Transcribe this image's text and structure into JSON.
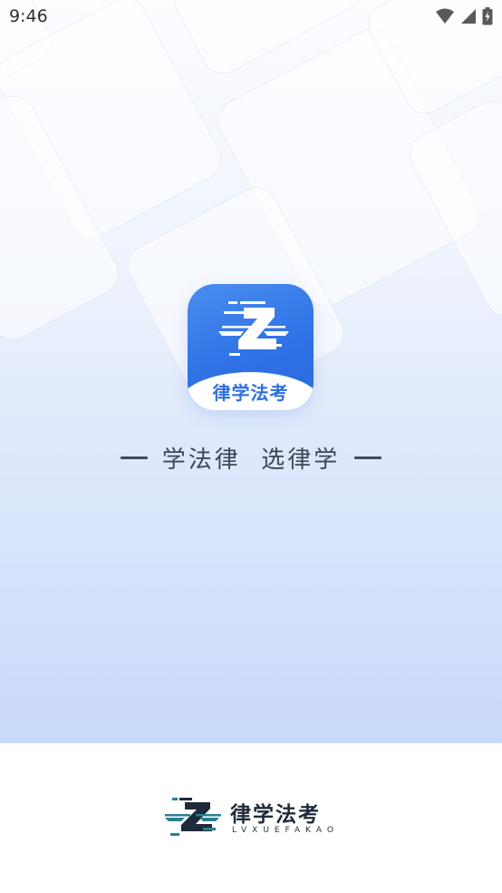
{
  "status_bar": {
    "time": "9:46",
    "icons": [
      "wifi-icon",
      "signal-icon",
      "battery-charging-icon"
    ]
  },
  "app_icon": {
    "label": "律学法考",
    "colors": {
      "primary": "#2f72e6",
      "light": "#4a8df0",
      "label": "#2d6fe3"
    }
  },
  "slogan": {
    "text": "学法律  选律学"
  },
  "footer_brand": {
    "name": "律学法考",
    "pinyin": "LVXUEFAKAO",
    "colors": {
      "dark": "#1f2a3a",
      "accent": "#2a7f8f"
    }
  }
}
